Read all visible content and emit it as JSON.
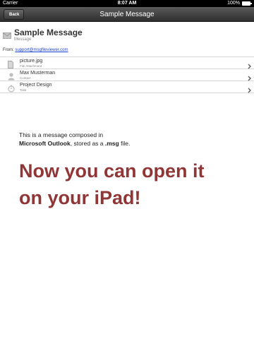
{
  "status_bar": {
    "carrier": "Carrier",
    "time": "8:07 AM",
    "battery": "100%"
  },
  "navbar": {
    "back_label": "Back",
    "title": "Sample Message"
  },
  "message": {
    "subject": "Sample Message",
    "kind": "Message",
    "from_label": "From:",
    "from_address": "support@msgfileviewer.com"
  },
  "attachments": [
    {
      "name": "picture.jpg",
      "type": "File Attachment",
      "icon": "document-icon"
    },
    {
      "name": "Max Musterman",
      "type": "Contact",
      "icon": "contact-icon"
    },
    {
      "name": "Project Design",
      "type": "Task",
      "icon": "timer-icon"
    }
  ],
  "body": {
    "line1": "This is a message composed in",
    "line2_bold": "Microsoft Outlook",
    "line2_mid": ", stored as a ",
    "line2_ext": ".msg",
    "line2_end": " file.",
    "headline_line1": "Now you can open it",
    "headline_line2": "on your iPad!"
  },
  "colors": {
    "headline": "#913636",
    "link": "#1a3fd0",
    "navbar": "#3a3a3a"
  }
}
